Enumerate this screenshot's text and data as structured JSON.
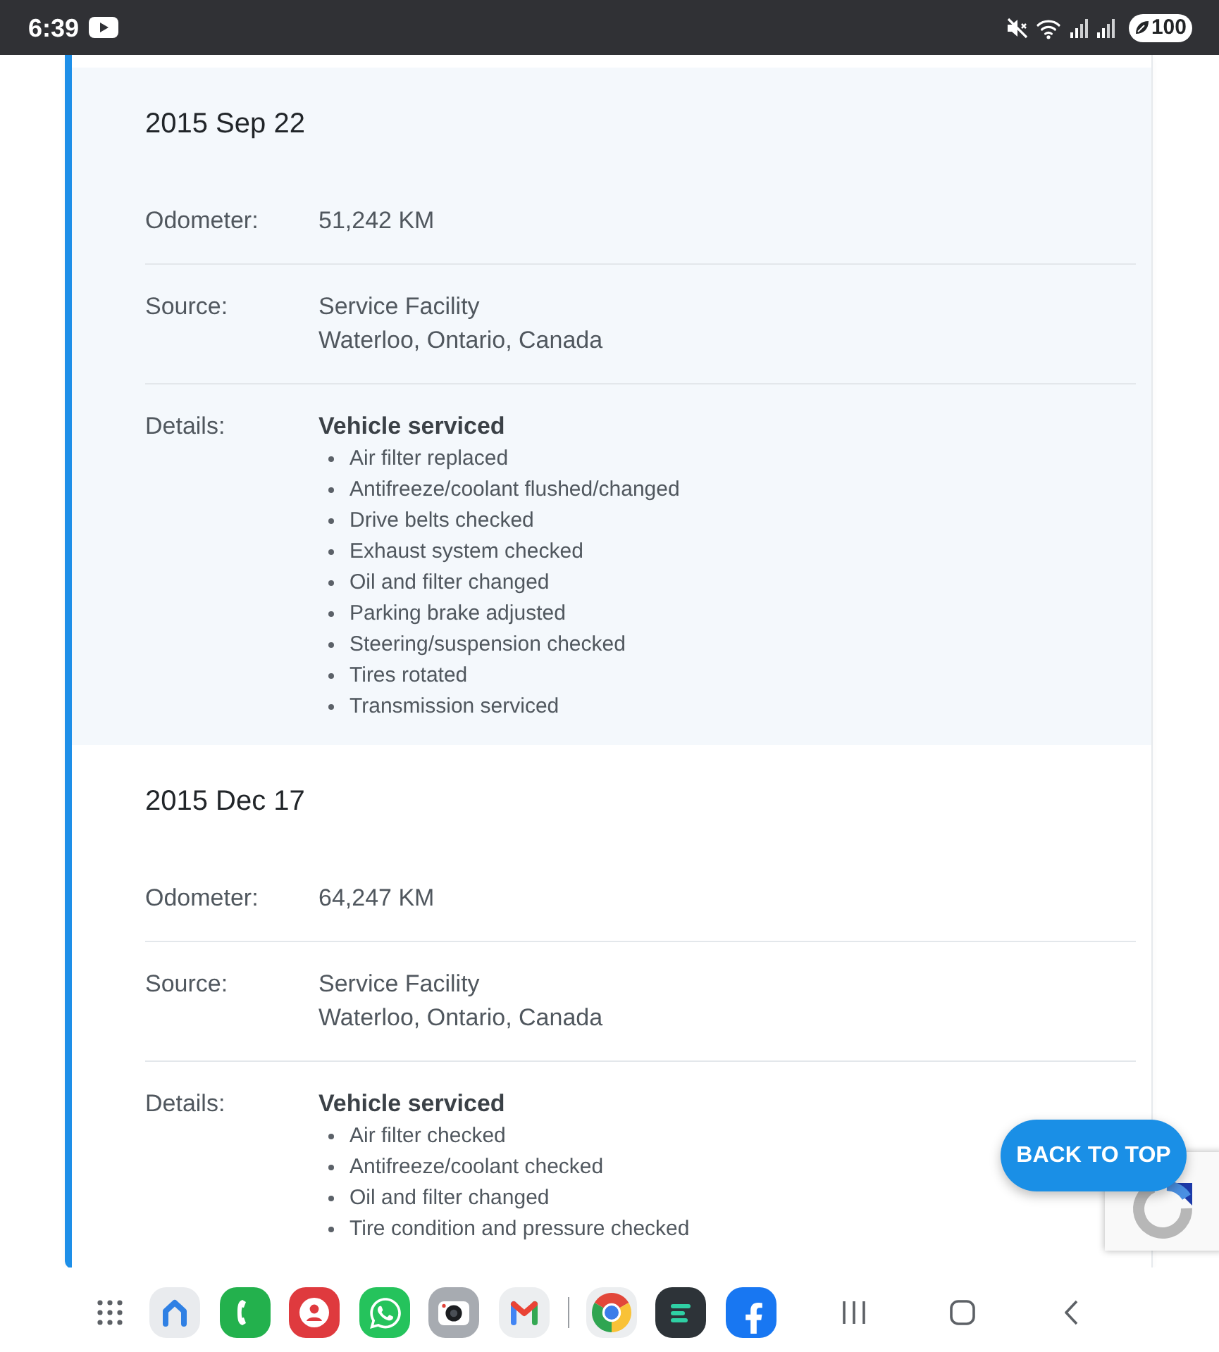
{
  "status_bar": {
    "time": "6:39",
    "battery": "100"
  },
  "records": [
    {
      "date": "2015 Sep 22",
      "rows": [
        {
          "kind": "text",
          "label": "Odometer:",
          "lines": [
            "51,242 KM"
          ]
        },
        {
          "kind": "text",
          "label": "Source:",
          "lines": [
            "Service Facility",
            "Waterloo, Ontario, Canada"
          ]
        },
        {
          "kind": "list",
          "label": "Details:",
          "heading": "Vehicle serviced",
          "items": [
            "Air filter replaced",
            "Antifreeze/coolant flushed/changed",
            "Drive belts checked",
            "Exhaust system checked",
            "Oil and filter changed",
            "Parking brake adjusted",
            "Steering/suspension checked",
            "Tires rotated",
            "Transmission serviced"
          ]
        }
      ]
    },
    {
      "date": "2015 Dec 17",
      "rows": [
        {
          "kind": "text",
          "label": "Odometer:",
          "lines": [
            "64,247 KM"
          ]
        },
        {
          "kind": "text",
          "label": "Source:",
          "lines": [
            "Service Facility",
            "Waterloo, Ontario, Canada"
          ]
        },
        {
          "kind": "list",
          "label": "Details:",
          "heading": "Vehicle serviced",
          "items": [
            "Air filter checked",
            "Antifreeze/coolant checked",
            "Oil and filter changed",
            "Tire condition and pressure checked"
          ]
        }
      ]
    }
  ],
  "back_to_top": {
    "label": "BACK TO TOP"
  }
}
